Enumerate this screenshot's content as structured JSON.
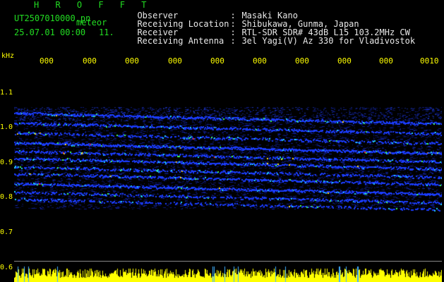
{
  "header": {
    "station": "H R O F F T",
    "filename": "UT2507010000.pn",
    "label": "meteor",
    "timestamp": "25.07.01 00:00",
    "count": "11."
  },
  "info": {
    "rows": [
      {
        "key": "Observer",
        "sep": ":",
        "value": "Masaki Kano"
      },
      {
        "key": "Receiving Location",
        "sep": ":",
        "value": "Shibukawa, Gunma, Japan"
      },
      {
        "key": "Receiver",
        "sep": ":",
        "value": "RTL-SDR SDR# 43dB L15 103.2MHz CW"
      },
      {
        "key": "Receiving Antenna",
        "sep": ":",
        "value": "3el Yagi(V) Az 330 for Vladivostok"
      }
    ]
  },
  "axes": {
    "y_unit": "kHz",
    "y_ticks": [
      "1.1",
      "1.0",
      "0.9",
      "0.8",
      "0.7",
      "0.6"
    ],
    "x_ticks": [
      "000",
      "000",
      "000",
      "000",
      "000",
      "000",
      "000",
      "000",
      "000",
      "0010"
    ]
  },
  "colors": {
    "header_green": "#22dd22",
    "text_white": "#e8e8e8",
    "axis_yellow": "#ffff00",
    "background": "#000000",
    "spectrum_blue": "#1030c0"
  }
}
